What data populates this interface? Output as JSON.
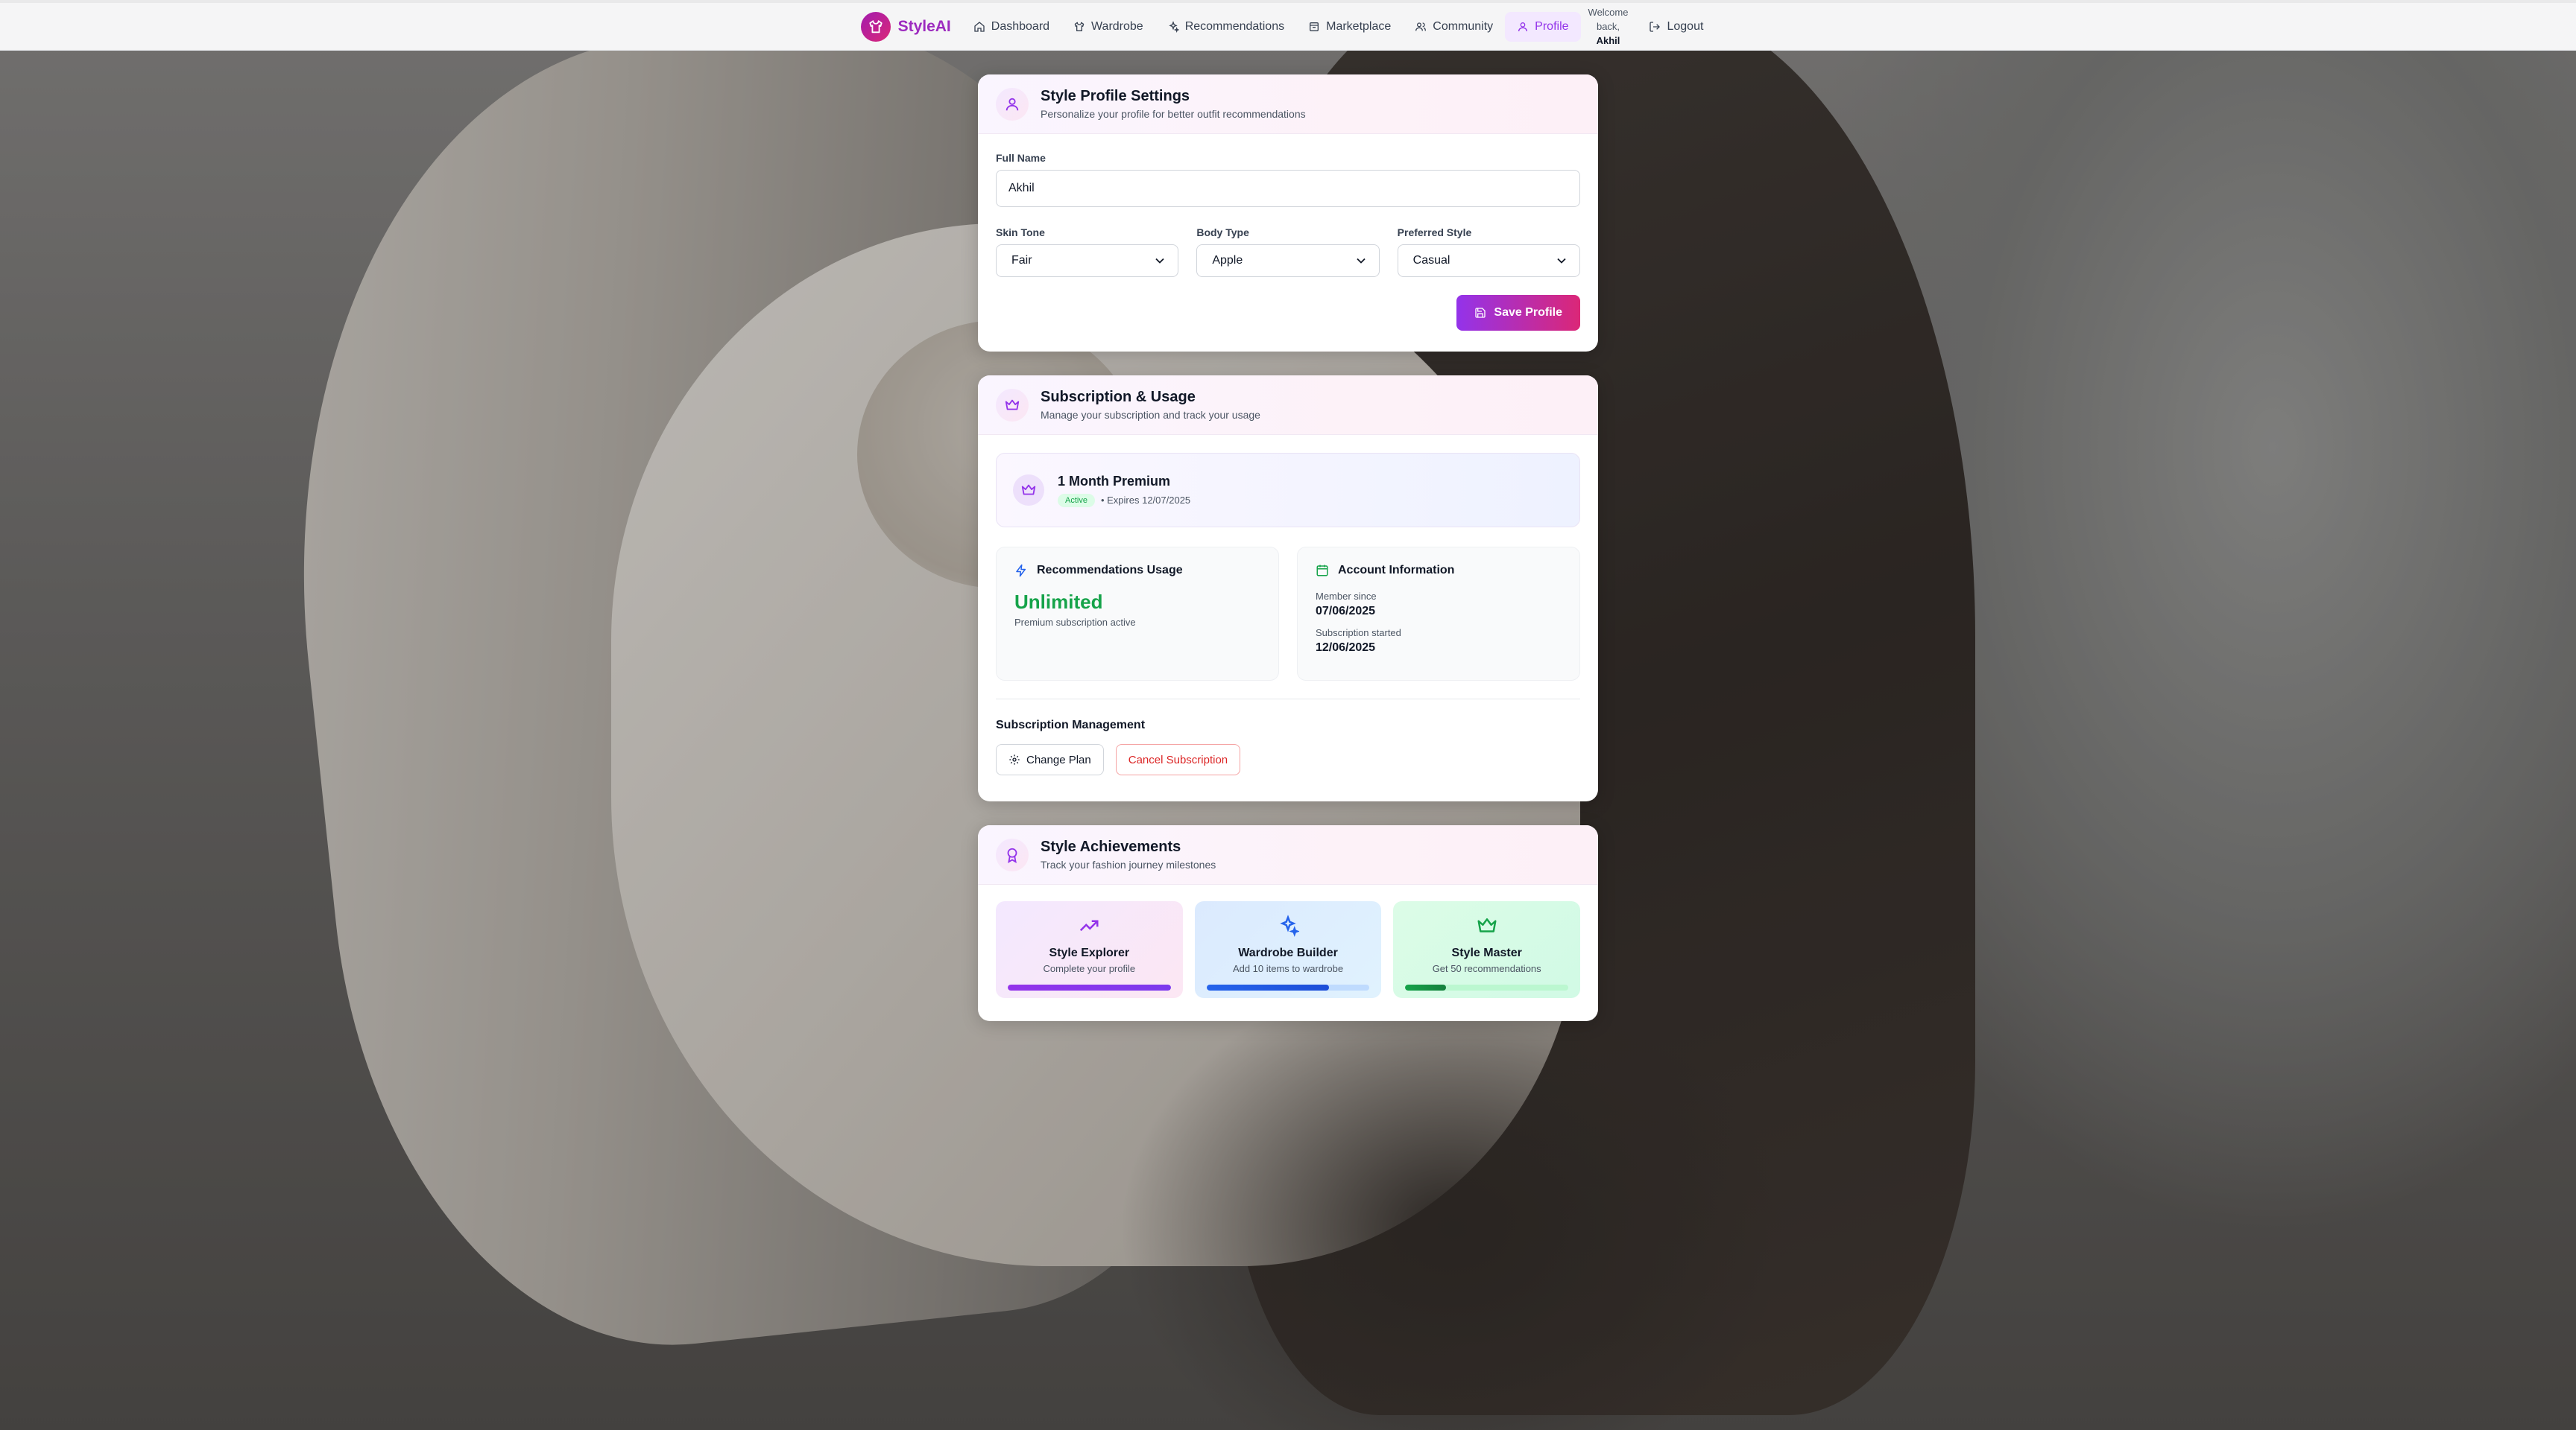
{
  "app": {
    "brand": "StyleAI"
  },
  "nav": {
    "items": [
      {
        "label": "Dashboard",
        "icon": "home-icon"
      },
      {
        "label": "Wardrobe",
        "icon": "shirt-icon"
      },
      {
        "label": "Recommendations",
        "icon": "sparkles-icon"
      },
      {
        "label": "Marketplace",
        "icon": "store-icon"
      },
      {
        "label": "Community",
        "icon": "users-icon"
      },
      {
        "label": "Profile",
        "icon": "user-icon",
        "active": true
      }
    ],
    "welcome_line1": "Welcome",
    "welcome_line2": "back,",
    "username": "Akhil",
    "logout": "Logout"
  },
  "profile": {
    "title": "Style Profile Settings",
    "subtitle": "Personalize your profile for better outfit recommendations",
    "full_name_label": "Full Name",
    "full_name_value": "Akhil",
    "skin_tone_label": "Skin Tone",
    "skin_tone_value": "Fair",
    "body_type_label": "Body Type",
    "body_type_value": "Apple",
    "preferred_style_label": "Preferred Style",
    "preferred_style_value": "Casual",
    "save_label": "Save Profile"
  },
  "subscription": {
    "title": "Subscription & Usage",
    "subtitle": "Manage your subscription and track your usage",
    "plan_name": "1 Month Premium",
    "status": "Active",
    "expires": "• Expires 12/07/2025",
    "usage_title": "Recommendations Usage",
    "usage_value": "Unlimited",
    "usage_note": "Premium subscription active",
    "account_title": "Account Information",
    "member_since_label": "Member since",
    "member_since_value": "07/06/2025",
    "sub_started_label": "Subscription started",
    "sub_started_value": "12/06/2025",
    "management_title": "Subscription Management",
    "change_plan": "Change Plan",
    "cancel": "Cancel Subscription"
  },
  "achievements": {
    "title": "Style Achievements",
    "subtitle": "Track your fashion journey milestones",
    "items": [
      {
        "title": "Style Explorer",
        "desc": "Complete your profile",
        "progress": 1.0,
        "color": "#9333ea",
        "icon": "trending-up-icon"
      },
      {
        "title": "Wardrobe Builder",
        "desc": "Add 10 items to wardrobe",
        "progress": 0.75,
        "color": "#2563eb",
        "icon": "sparkles-icon"
      },
      {
        "title": "Style Master",
        "desc": "Get 50 recommendations",
        "progress": 0.25,
        "color": "#16a34a",
        "icon": "crown-icon"
      }
    ]
  }
}
